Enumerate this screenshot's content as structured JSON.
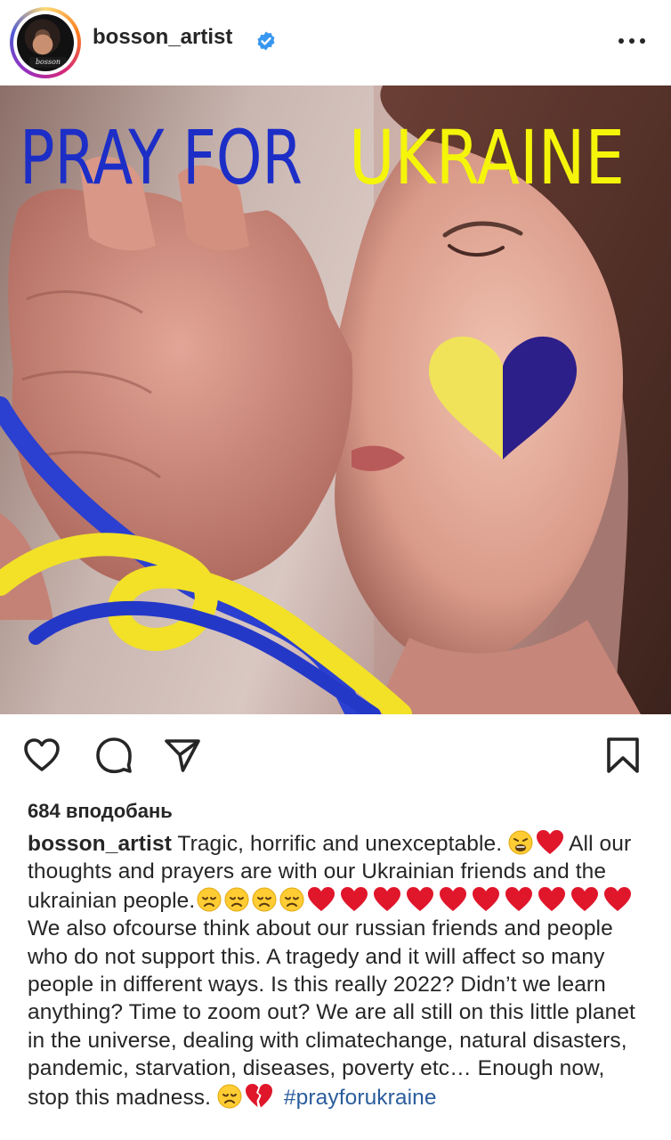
{
  "post": {
    "username": "bosson_artist",
    "avatar_tag": "bosson",
    "image": {
      "headline_blue": "PRAY FOR",
      "headline_yellow": "UKRAINE",
      "accent_blue": "#1d2ec7",
      "accent_yellow": "#f5f50a"
    },
    "likes_text": "684 вподобань",
    "caption": {
      "seg1": " Tragic, horrific and unexceptable. ",
      "seg2": "All our thoughts and prayers are with our Ukrainian friends and the ukrainian people.",
      "seg3": " We also ofcourse think about our russian friends and people who do not support this. A tragedy and it will affect so many people in different ways. Is this really 2022? Didn’t we learn anything? Time to zoom out? We are all still on this little planet in the universe, dealing with climatechange, natural disasters, pandemic, starvation, diseases, poverty etc… Enough now, stop this madness. ",
      "hashtag": "#prayforukraine"
    }
  },
  "icons": {
    "verified": "verified-badge-icon",
    "more": "more-options-icon",
    "like": "heart-outline-icon",
    "comment": "comment-icon",
    "share": "share-icon",
    "save": "bookmark-icon"
  }
}
